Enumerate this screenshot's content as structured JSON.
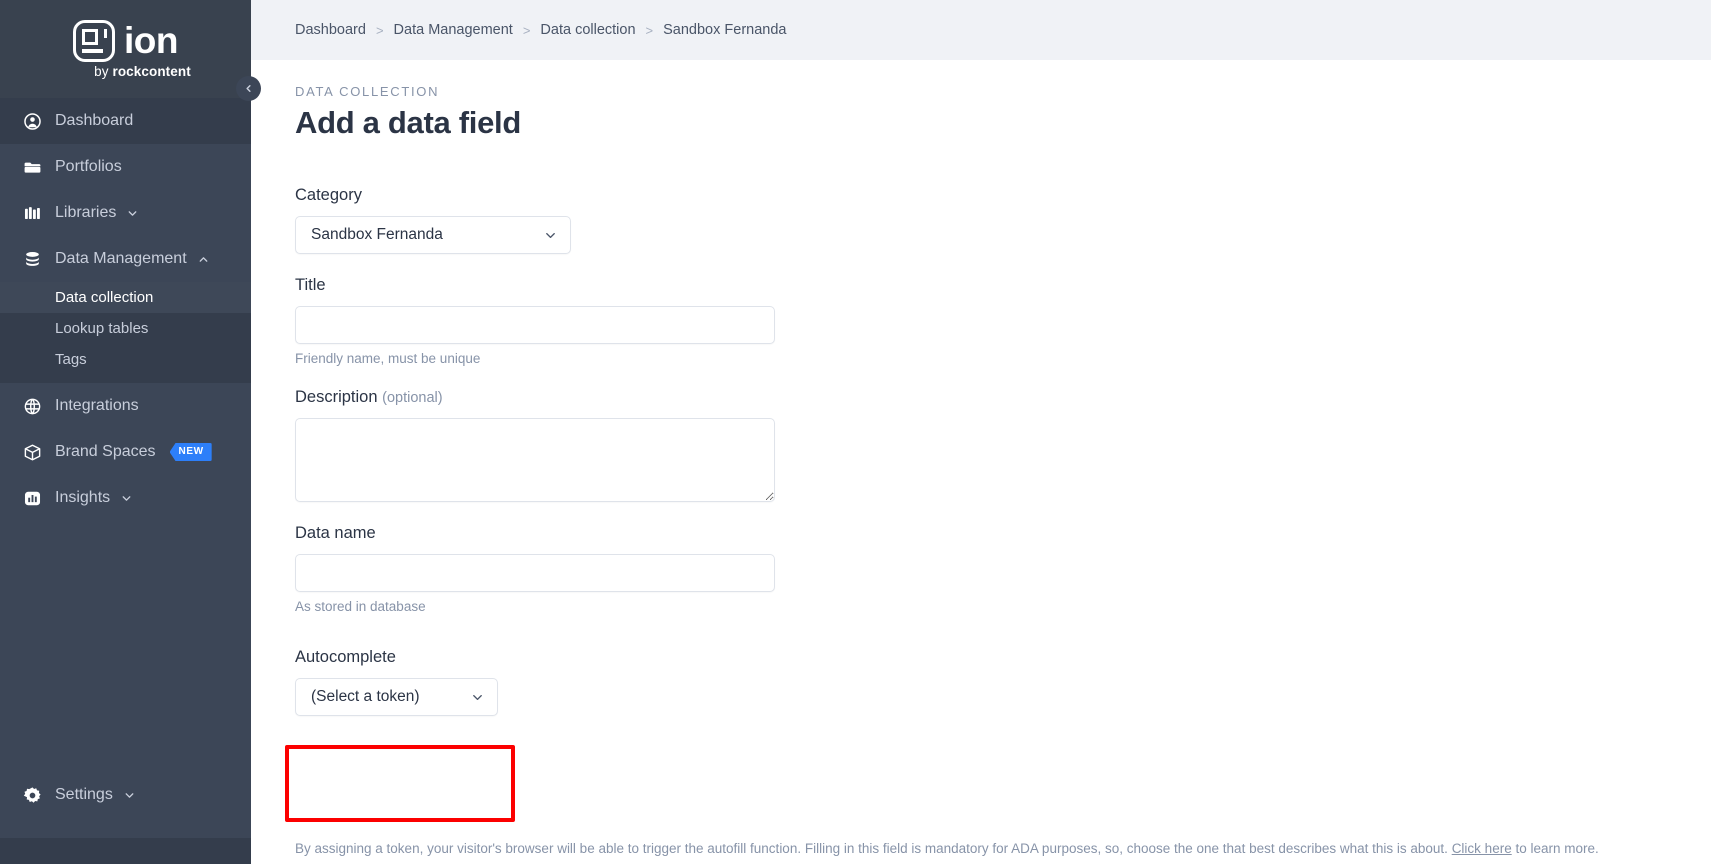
{
  "brand": {
    "name": "ion",
    "tagline_prefix": "by ",
    "tagline_brand": "rockcontent",
    "logo_icon": "ion-logo-icon"
  },
  "sidebar": {
    "collapse_icon": "chevron-left-icon",
    "items": [
      {
        "label": "Dashboard",
        "icon": "user-circle-icon",
        "active": true,
        "chevron": null,
        "badge": null
      },
      {
        "label": "Portfolios",
        "icon": "folder-icon",
        "active": false,
        "chevron": null,
        "badge": null
      },
      {
        "label": "Libraries",
        "icon": "books-icon",
        "active": false,
        "chevron": "chevron-down-icon",
        "badge": null
      },
      {
        "label": "Data Management",
        "icon": "database-icon",
        "active": false,
        "chevron": "chevron-up-icon",
        "badge": null
      }
    ],
    "subitems": [
      {
        "label": "Data collection",
        "active": true
      },
      {
        "label": "Lookup tables",
        "active": false
      },
      {
        "label": "Tags",
        "active": false
      }
    ],
    "items_after": [
      {
        "label": "Integrations",
        "icon": "integrations-icon",
        "active": false,
        "chevron": null,
        "badge": null
      },
      {
        "label": "Brand Spaces",
        "icon": "cube-icon",
        "active": false,
        "chevron": null,
        "badge": "NEW"
      },
      {
        "label": "Insights",
        "icon": "insights-chart-icon",
        "active": false,
        "chevron": "chevron-down-icon",
        "badge": null
      }
    ],
    "settings": {
      "label": "Settings",
      "icon": "gear-icon",
      "chevron": "chevron-down-icon"
    }
  },
  "breadcrumb": {
    "separator": ">",
    "items": [
      "Dashboard",
      "Data Management",
      "Data collection",
      "Sandbox Fernanda"
    ]
  },
  "page": {
    "eyebrow": "DATA COLLECTION",
    "title": "Add a data field"
  },
  "form": {
    "category": {
      "label": "Category",
      "value": "Sandbox Fernanda",
      "chevron_icon": "chevron-down-icon"
    },
    "title": {
      "label": "Title",
      "value": "",
      "placeholder": "",
      "helper": "Friendly name, must be unique"
    },
    "description": {
      "label": "Description",
      "optional_suffix": "(optional)",
      "value": "",
      "placeholder": "",
      "resize_handle_icon": "resize-handle-icon"
    },
    "data_name": {
      "label": "Data name",
      "value": "",
      "placeholder": "",
      "helper": "As stored in database"
    },
    "autocomplete": {
      "label": "Autocomplete",
      "value": "(Select a token)",
      "chevron_icon": "chevron-down-icon",
      "highlight_color": "#fc0000",
      "helper_before_link": "By assigning a token, your visitor's browser will be able to trigger the autofill function. Filling in this field is mandatory for ADA purposes, so, choose the one that best describes what this is about. ",
      "helper_link": "Click here",
      "helper_after_link": " to learn more."
    }
  },
  "colors": {
    "sidebar_bg": "#3c4657",
    "sidebar_logo_bg": "#39424f",
    "sidebar_active": "#343d4c",
    "breadcrumb_bg": "#f0f2f6",
    "badge_blue": "#2d7ff9",
    "highlight_red": "#fc0000",
    "text_dark": "#2b3445",
    "text_muted": "#8793a8"
  }
}
